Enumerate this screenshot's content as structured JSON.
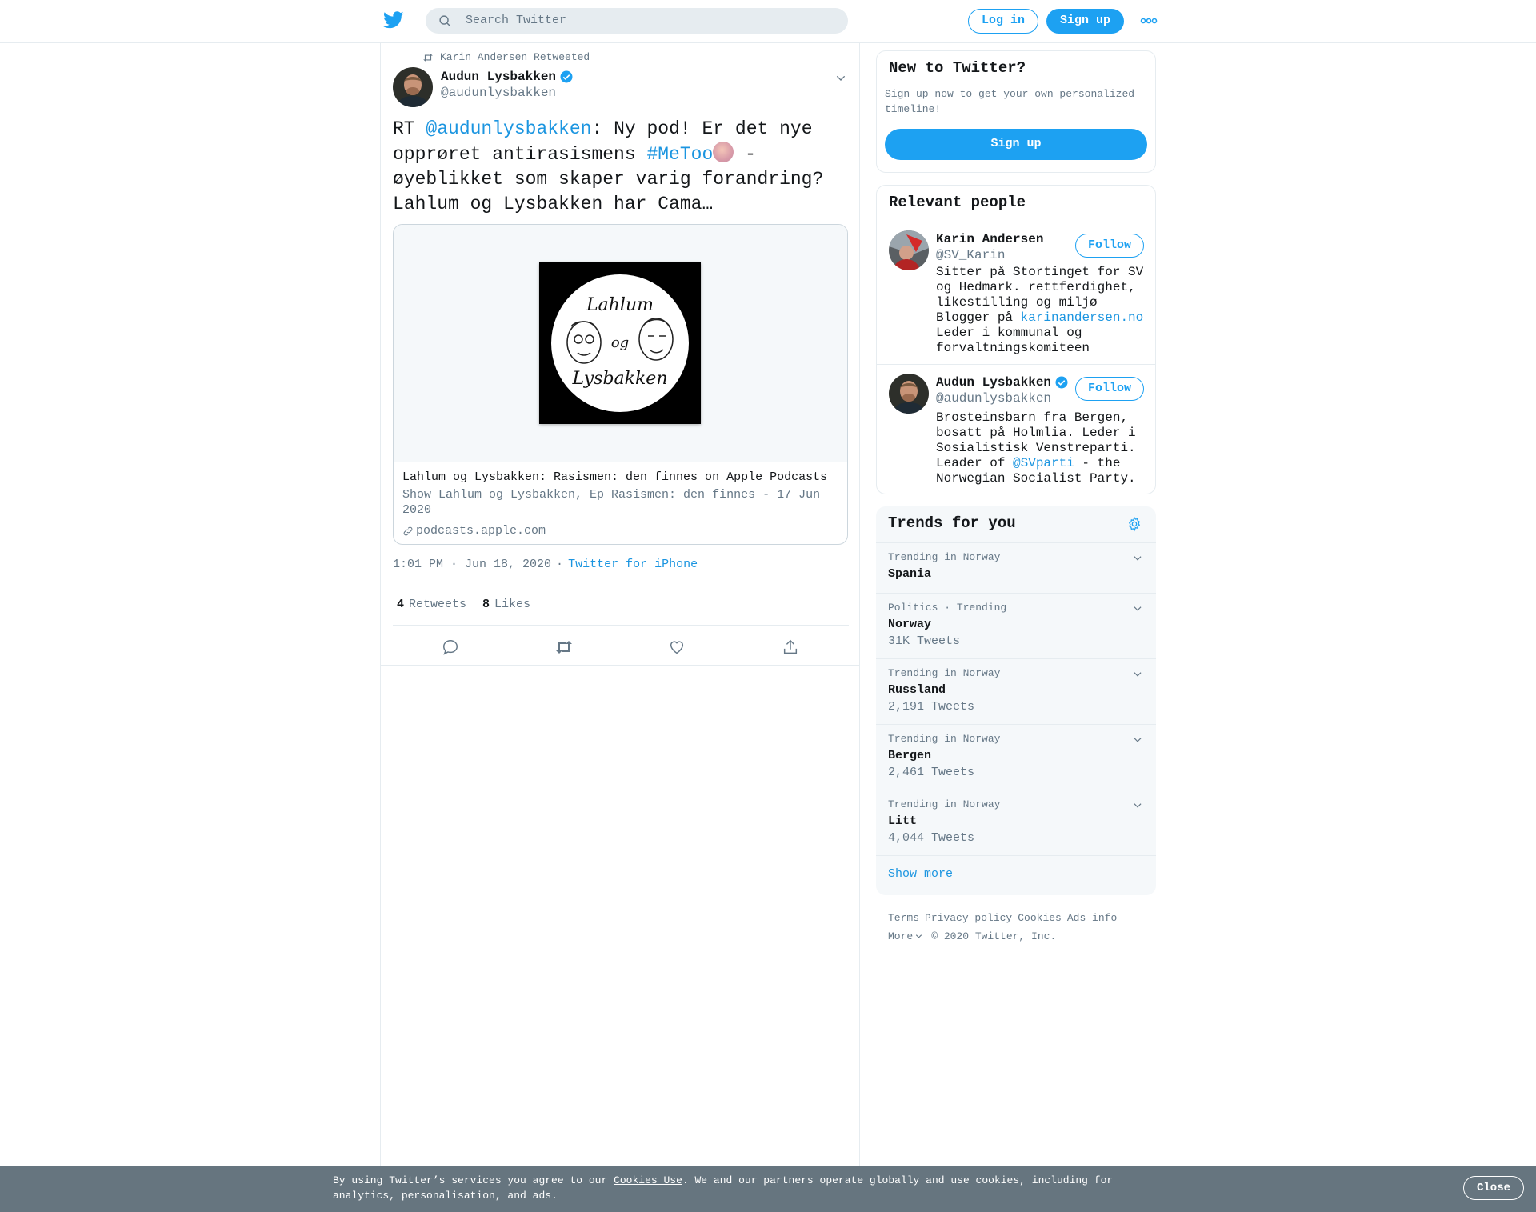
{
  "header": {
    "search_placeholder": "Search Twitter",
    "login_label": "Log in",
    "signup_label": "Sign up",
    "logo_icon": "twitter-bird-icon",
    "more_icon": "more-dots-icon"
  },
  "tweet": {
    "retweet_context": "Karin Andersen Retweeted",
    "author_name": "Audun Lysbakken",
    "author_handle": "@audunlysbakken",
    "text_prefix": "RT ",
    "text_mention": "@audunlysbakken",
    "text_part2": ": Ny pod! Er det nye opprøret antirasismens ",
    "text_hashtag": "#MeToo",
    "text_part3": " - øyeblikket som skaper varig forandring? Lahlum og Lysbakken har Cama…",
    "card": {
      "title": "Lahlum og Lysbakken: Rasismen: den finnes on Apple Podcasts",
      "description": "Show Lahlum og Lysbakken, Ep Rasismen: den finnes - 17 Jun 2020",
      "domain": "podcasts.apple.com",
      "cover_text_top": "Lahlum",
      "cover_text_mid": "og",
      "cover_text_bottom": "Lysbakken"
    },
    "time": "1:01 PM · Jun 18, 2020",
    "separator": "·",
    "source": "Twitter for iPhone",
    "retweets_count": "4",
    "retweets_label": "Retweets",
    "likes_count": "8",
    "likes_label": "Likes"
  },
  "sidebar": {
    "new_to_twitter": {
      "title": "New to Twitter?",
      "subtitle": "Sign up now to get your own personalized timeline!",
      "button": "Sign up"
    },
    "relevant_people": {
      "title": "Relevant people",
      "people": [
        {
          "name": "Karin Andersen",
          "handle": "@SV_Karin",
          "bio_1": "Sitter på Stortinget for SV og Hedmark. rettferdighet, likestilling og miljø Blogger på ",
          "bio_link": "karinandersen.no",
          "bio_2": " Leder i kommunal og forvaltningskomiteen",
          "follow": "Follow"
        },
        {
          "name": "Audun Lysbakken",
          "handle": "@audunlysbakken",
          "bio_1": "Brosteinsbarn fra Bergen, bosatt på Holmlia. Leder i Sosialistisk Venstreparti. Leader of ",
          "bio_link": "@SVparti",
          "bio_2": " - the Norwegian Socialist Party.",
          "follow": "Follow"
        }
      ]
    },
    "trends": {
      "title": "Trends for you",
      "items": [
        {
          "context": "Trending in Norway",
          "name": "Spania",
          "count": ""
        },
        {
          "context": "Politics · Trending",
          "name": "Norway",
          "count": "31K Tweets"
        },
        {
          "context": "Trending in Norway",
          "name": "Russland",
          "count": "2,191 Tweets"
        },
        {
          "context": "Trending in Norway",
          "name": "Bergen",
          "count": "2,461 Tweets"
        },
        {
          "context": "Trending in Norway",
          "name": "Litt",
          "count": "4,044 Tweets"
        }
      ],
      "show_more": "Show more"
    },
    "footer": {
      "terms": "Terms",
      "privacy": "Privacy policy",
      "cookies": "Cookies",
      "ads": "Ads info",
      "more": "More",
      "copyright": "© 2020 Twitter, Inc."
    }
  },
  "cookie_banner": {
    "text_1": "By using Twitter’s services you agree to our ",
    "link": "Cookies Use",
    "text_2": ". We and our partners operate globally and use cookies, including for analytics, personalisation, and ads.",
    "close": "Close"
  },
  "colors": {
    "accent": "#1da1f2",
    "link": "#1b95e0",
    "muted": "#657786",
    "cookie_bg": "#66757f"
  }
}
